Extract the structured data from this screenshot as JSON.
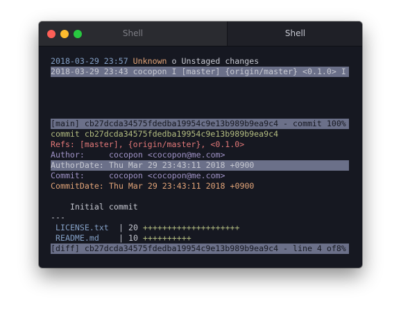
{
  "window": {
    "tabs": [
      {
        "label": "Shell"
      },
      {
        "label": "Shell"
      }
    ]
  },
  "log": [
    {
      "date": "2018-03-29 23:57",
      "author": "Unknown",
      "graph": "o",
      "message": "Unstaged changes"
    },
    {
      "date": "2018-03-29 23:43",
      "author": "cocopon",
      "graph": "I",
      "message": "[master] {origin/master} <0.1.0> I"
    }
  ],
  "status_main": "[main] cb27dcda34575fdedba19954c9e13b989b9ea9c4 - commit 100%",
  "commit": {
    "hash_line": "commit cb27dcda34575fdedba19954c9e13b989b9ea9c4",
    "refs_line": "Refs: [master], {origin/master}, <0.1.0>",
    "author_key": "Author:",
    "author_val": "cocopon <cocopon@me.com>",
    "authordate_key": "AuthorDate:",
    "authordate_val": "Thu Mar 29 23:43:11 2018 +0900",
    "committer_key": "Commit:",
    "committer_val": "cocopon <cocopon@me.com>",
    "commitdate_key": "CommitDate:",
    "commitdate_val": "Thu Mar 29 23:43:11 2018 +0900",
    "message": "Initial commit",
    "separator": "---"
  },
  "diffstat": [
    {
      "file": "LICENSE.txt",
      "count": "20",
      "bar": "++++++++++++++++++++"
    },
    {
      "file": "README.md",
      "count": "10",
      "bar": "++++++++++"
    }
  ],
  "status_diff": "[diff] cb27dcda34575fdedba19954c9e13b989b9ea9c4 - line 4 of8%",
  "colors": {
    "background": "#161821",
    "highlight": "#6b7089",
    "date": "#84a0c6",
    "unknown": "#e2a478",
    "hash": "#b4be82",
    "refs": "#e27878",
    "author_key": "#a093c7",
    "commitdate": "#e2a478"
  }
}
